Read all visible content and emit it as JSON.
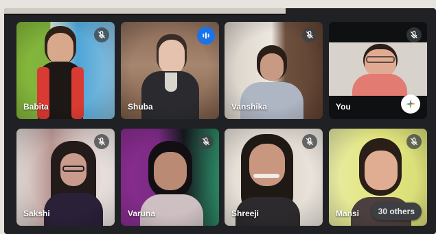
{
  "participants": [
    {
      "name": "Babita",
      "muted": true,
      "speaking": false
    },
    {
      "name": "Shuba",
      "muted": false,
      "speaking": true
    },
    {
      "name": "Vanshika",
      "muted": true,
      "speaking": false
    },
    {
      "name": "You",
      "muted": true,
      "speaking": false
    },
    {
      "name": "Sakshi",
      "muted": true,
      "speaking": false
    },
    {
      "name": "Varuna",
      "muted": true,
      "speaking": false
    },
    {
      "name": "Shreeji",
      "muted": true,
      "speaking": false
    },
    {
      "name": "Mansi",
      "muted": true,
      "speaking": false
    }
  ],
  "overflow": {
    "label": "30 others"
  },
  "icons": {
    "muted": "mic-off-icon",
    "speaking": "speaking-icon",
    "effects": "sparkle-icon"
  },
  "colors": {
    "background": "#202124",
    "accent": "#1a73e8"
  }
}
